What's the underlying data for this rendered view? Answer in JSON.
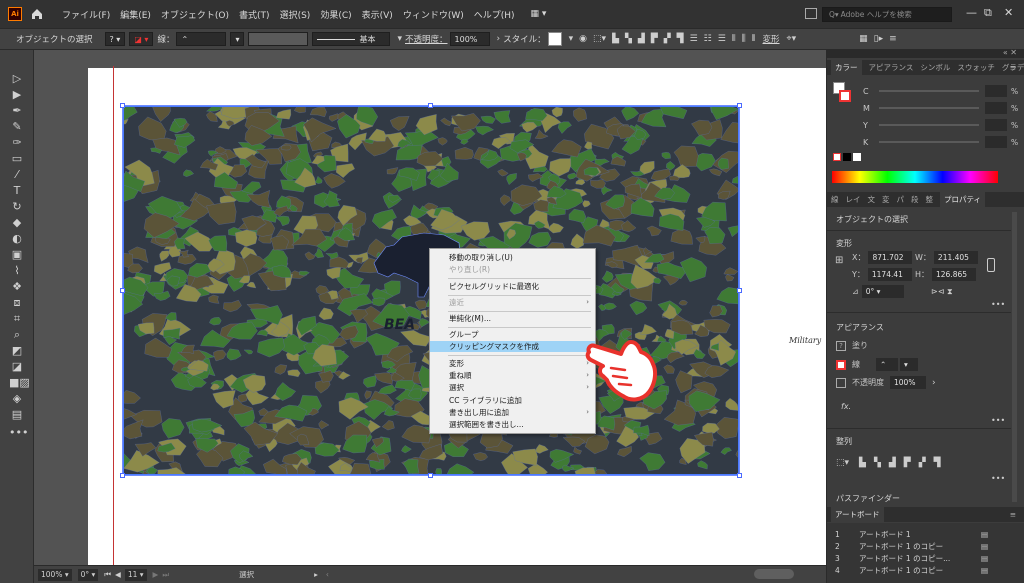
{
  "menubar": {
    "app_logo": "Ai",
    "items": [
      "ファイル(F)",
      "編集(E)",
      "オブジェクト(O)",
      "書式(T)",
      "選択(S)",
      "効果(C)",
      "表示(V)",
      "ウィンドウ(W)",
      "ヘルプ(H)"
    ],
    "search_placeholder": "Adobe ヘルプを検索"
  },
  "controlbar": {
    "selection_label": "オブジェクトの選択",
    "stroke_label": "線：",
    "stroke_style": "基本",
    "opacity_label": "不透明度：",
    "opacity_value": "100%",
    "style_label": "スタイル：",
    "transform_label": "変形"
  },
  "statusbar": {
    "zoom": "100%",
    "rotation": "0°",
    "artboard_num": "11",
    "tool_name": "選択"
  },
  "canvas": {
    "side_text": "Military",
    "logo_text": "BEA"
  },
  "context_menu": {
    "items": [
      {
        "label": "移動の取り消し(U)",
        "state": "normal",
        "submenu": false
      },
      {
        "label": "やり直し(R)",
        "state": "disabled",
        "submenu": false
      },
      {
        "label": "ピクセルグリッドに最適化",
        "state": "normal",
        "submenu": false
      },
      {
        "label": "遠近",
        "state": "disabled",
        "submenu": true
      },
      {
        "label": "単純化(M)...",
        "state": "normal",
        "submenu": false
      },
      {
        "label": "グループ",
        "state": "normal",
        "submenu": false
      },
      {
        "label": "クリッピングマスクを作成",
        "state": "highlight",
        "submenu": false
      },
      {
        "label": "変形",
        "state": "normal",
        "submenu": true
      },
      {
        "label": "重ね順",
        "state": "normal",
        "submenu": true
      },
      {
        "label": "選択",
        "state": "normal",
        "submenu": true
      },
      {
        "label": "CC ライブラリに追加",
        "state": "normal",
        "submenu": false
      },
      {
        "label": "書き出し用に追加",
        "state": "normal",
        "submenu": true
      },
      {
        "label": "選択範囲を書き出し...",
        "state": "normal",
        "submenu": false
      }
    ]
  },
  "color_panel": {
    "tabs": [
      "カラー",
      "アピアランス",
      "シンボル",
      "スウォッチ",
      "グラデーション"
    ],
    "channels": [
      {
        "label": "C",
        "unit": "%"
      },
      {
        "label": "M",
        "unit": "%"
      },
      {
        "label": "Y",
        "unit": "%"
      },
      {
        "label": "K",
        "unit": "%"
      }
    ]
  },
  "properties_panel": {
    "tabs": [
      "線",
      "レイ",
      "文",
      "変",
      "パ",
      "段",
      "整",
      "プロパティ"
    ],
    "object_type": "オブジェクトの選択",
    "transform_title": "変形",
    "x_label": "X：",
    "x_value": "871.702",
    "w_label": "W：",
    "w_value": "211.405",
    "y_label": "Y：",
    "y_value": "1174.41",
    "h_label": "H：",
    "h_value": "126.865",
    "angle_value": "0°",
    "appearance_title": "アピアランス",
    "fill_label": "塗り",
    "stroke_label": "線",
    "opacity_label": "不透明度",
    "opacity_value": "100%",
    "fx_label": "fx.",
    "align_title": "整列",
    "pathfinder_title": "パスファインダー"
  },
  "artboards_panel": {
    "title": "アートボード",
    "rows": [
      {
        "num": "1",
        "name": "アートボード 1"
      },
      {
        "num": "2",
        "name": "アートボード 1 のコピー"
      },
      {
        "num": "3",
        "name": "アートボード 1 のコピー..."
      },
      {
        "num": "4",
        "name": "アートボード 1 のコピー"
      }
    ]
  },
  "colors": {
    "menubar_bg": "#323232",
    "panel_bg": "#3c3c3c",
    "highlight": "#9ed3f6",
    "selection": "#4a7bff",
    "camo_base": "#323a45",
    "camo_green": "#3f7a34",
    "camo_olive": "#8c8a4a",
    "camo_brown": "#5b5438"
  }
}
